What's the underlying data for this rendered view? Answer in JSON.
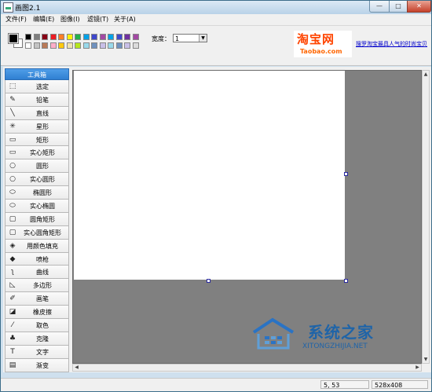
{
  "window": {
    "title": "画图2.1"
  },
  "menu": [
    "文件(F)",
    "编辑(E)",
    "图像(I)",
    "滤镜(T)",
    "关于(A)"
  ],
  "palette": {
    "row1": [
      "#000000",
      "#7f7f7f",
      "#880015",
      "#ed1c24",
      "#ff7f27",
      "#fff200",
      "#22b14c",
      "#00a2e8",
      "#3f48cc",
      "#a349a4",
      "#00a2e8",
      "#3f48cc",
      "#7030a0",
      "#a349a4"
    ],
    "row2": [
      "#ffffff",
      "#c3c3c3",
      "#b97a57",
      "#ffaec9",
      "#ffc90e",
      "#efe4b0",
      "#b5e61d",
      "#99d9ea",
      "#7092be",
      "#c8bfe7",
      "#99d9ea",
      "#7092be",
      "#c8bfe7",
      "#dcdcdc"
    ],
    "foreground": "#000000",
    "background": "#ffffff"
  },
  "toolbar": {
    "width_label": "宽度：",
    "width_value": "1"
  },
  "ad": {
    "logo_cn": "淘宝网",
    "logo_en": "Taobao.com",
    "link_text": "搜罗淘宝最具人气的时尚宝贝"
  },
  "toolbox": {
    "header": "工具箱",
    "tools": [
      {
        "label": "选定",
        "icon": "select-icon"
      },
      {
        "label": "铅笔",
        "icon": "pencil-icon"
      },
      {
        "label": "直线",
        "icon": "line-icon"
      },
      {
        "label": "星形",
        "icon": "star-icon"
      },
      {
        "label": "矩形",
        "icon": "rectangle-icon"
      },
      {
        "label": "实心矩形",
        "icon": "filled-rectangle-icon"
      },
      {
        "label": "圆形",
        "icon": "circle-icon"
      },
      {
        "label": "实心圆形",
        "icon": "filled-circle-icon"
      },
      {
        "label": "椭圆形",
        "icon": "ellipse-icon"
      },
      {
        "label": "实心椭圆",
        "icon": "filled-ellipse-icon"
      },
      {
        "label": "圆角矩形",
        "icon": "rounded-rectangle-icon"
      },
      {
        "label": "实心圆角矩形",
        "icon": "filled-rounded-rectangle-icon"
      },
      {
        "label": "用颜色填充",
        "icon": "paint-bucket-icon"
      },
      {
        "label": "喷枪",
        "icon": "airbrush-icon"
      },
      {
        "label": "曲线",
        "icon": "curve-icon"
      },
      {
        "label": "多边形",
        "icon": "polygon-icon"
      },
      {
        "label": "画笔",
        "icon": "brush-icon"
      },
      {
        "label": "橡皮擦",
        "icon": "eraser-icon"
      },
      {
        "label": "取色",
        "icon": "color-picker-icon"
      },
      {
        "label": "克隆",
        "icon": "clone-icon"
      },
      {
        "label": "文字",
        "icon": "text-icon"
      },
      {
        "label": "渐变",
        "icon": "gradient-icon"
      }
    ]
  },
  "status": {
    "coordinates": "5, 53",
    "canvas_size": "528x408"
  },
  "watermark": {
    "title": "系统之家",
    "subtitle": "XITONGZHIJIA.NET"
  }
}
